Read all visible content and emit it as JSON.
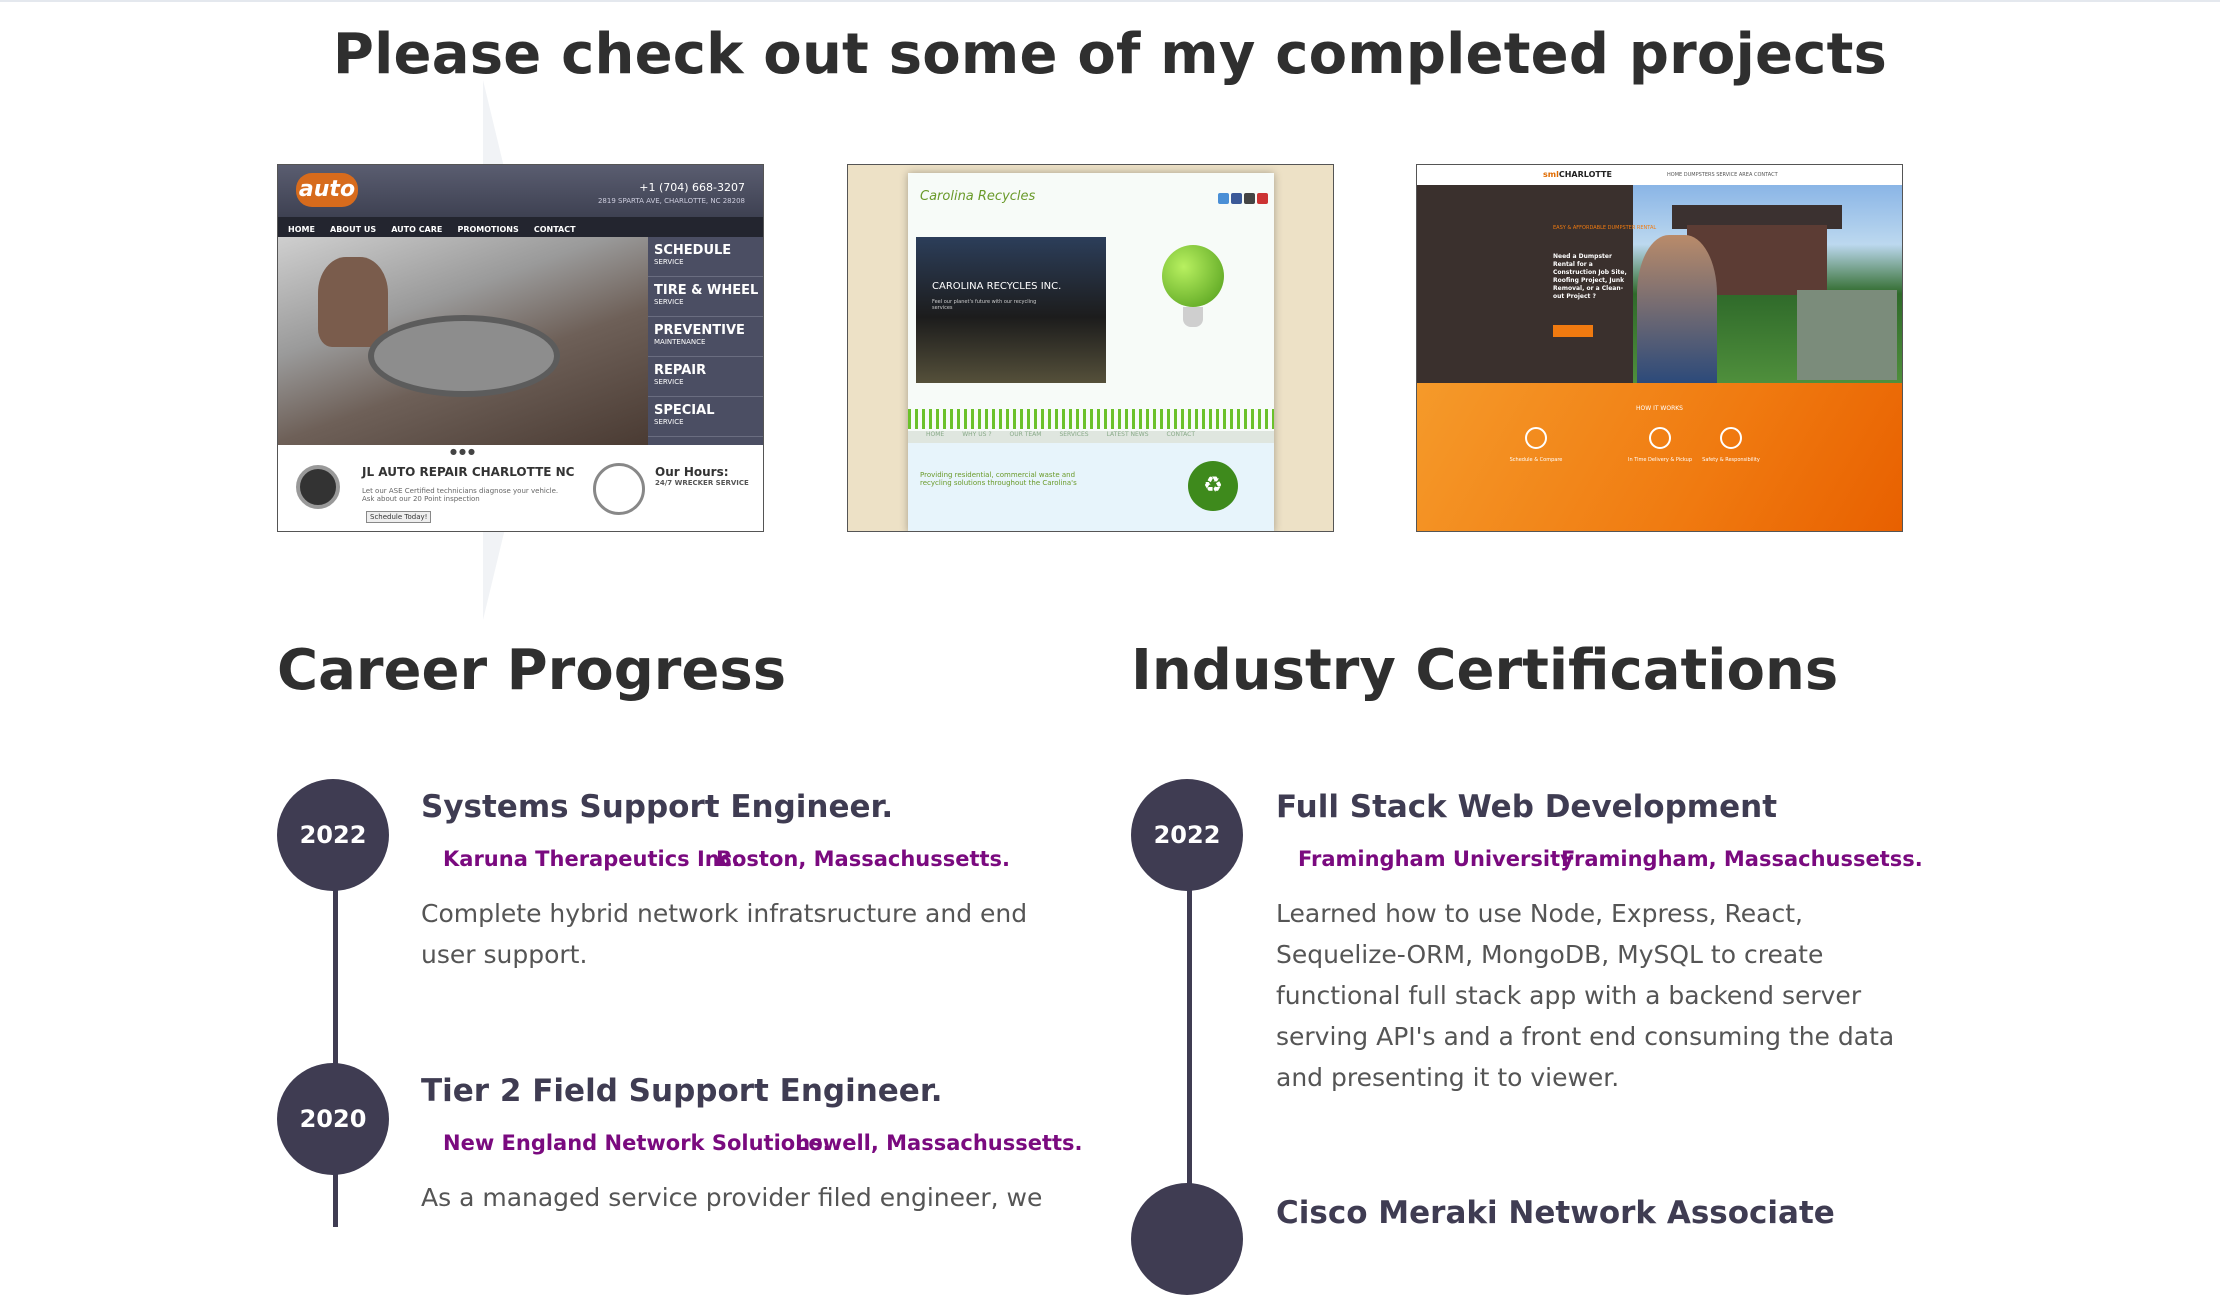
{
  "projects": {
    "title": "Please check out some of my completed projects",
    "thumb1": {
      "logo": "auto",
      "phone": "+1 (704) 668-3207",
      "address": "2819 SPARTA AVE, CHARLOTTE, NC 28208",
      "nav": [
        "HOME",
        "ABOUT US",
        "AUTO CARE",
        "PROMOTIONS",
        "CONTACT"
      ],
      "side_items": [
        {
          "label": "SCHEDULE",
          "sub": "SERVICE"
        },
        {
          "label": "TIRE & WHEEL",
          "sub": "SERVICE"
        },
        {
          "label": "PREVENTIVE",
          "sub": "MAINTENANCE"
        },
        {
          "label": "REPAIR",
          "sub": "SERVICE"
        },
        {
          "label": "SPECIAL",
          "sub": "SERVICE"
        }
      ],
      "company": "JL AUTO REPAIR CHARLOTTE NC",
      "blurb": "Let our ASE Certified technicians diagnose your vehicle. Ask about our 20 Point inspection",
      "button": "Schedule Today!",
      "hours_title": "Our Hours:",
      "hours_sub": "24/7 WRECKER SERVICE"
    },
    "thumb2": {
      "logo": "Carolina Recycles",
      "banner_title": "CAROLINA RECYCLES INC.",
      "banner_text": "Feel our planet's future with our recycling services",
      "nav": [
        "HOME",
        "WHY US ?",
        "OUR TEAM",
        "SERVICES",
        "LATEST NEWS",
        "CONTACT"
      ],
      "footer_text": "Providing residential, commercial waste and recycling solutions throughout the Carolina's"
    },
    "thumb3": {
      "logo_accent": "sml",
      "logo_text": "CHARLOTTE",
      "menu": "HOME  DUMPSTERS  SERVICE AREA  CONTACT",
      "tagline": "EASY & AFFORDABLE DUMPSTER RENTAL",
      "headline": "Need a Dumpster Rental for a Construction Job Site, Roofing Project, Junk Removal, or a Clean-out Project ?",
      "how": "HOW IT WORKS",
      "steps": [
        "Schedule & Compare",
        "In Time Delivery & Pickup",
        "Safety & Responsibility"
      ]
    }
  },
  "career": {
    "title": "Career Progress",
    "entries": [
      {
        "year": "2022",
        "role": "Systems Support Engineer.",
        "company": "Karuna Therapeutics Inc.",
        "location": "Boston, Massachussetts.",
        "desc_lines": [
          "Complete hybrid network infratsructure and end",
          "user support."
        ]
      },
      {
        "year": "2020",
        "role": "Tier 2 Field Support Engineer.",
        "company": "New England Network Solutions.",
        "location": "Lowell, Massachussetts.",
        "desc_lines": [
          "As a managed service provider filed engineer, we"
        ]
      }
    ]
  },
  "certifications": {
    "title": "Industry Certifications",
    "entries": [
      {
        "year": "2022",
        "role": "Full Stack Web Development",
        "company": "Framingham University",
        "location": "Framingham, Massachussetss.",
        "desc_lines": [
          "Learned how to use Node, Express, React,",
          "Sequelize-ORM, MongoDB, MySQL to create",
          "functional full stack app with a backend server",
          "serving API's and a front end consuming the data",
          "and presenting it to viewer."
        ]
      },
      {
        "year": "",
        "role": "Cisco Meraki Network Associate"
      }
    ]
  },
  "colors": {
    "timeline": "#3f3c52",
    "org": "#7a0a7f",
    "heading": "#2f2f2f"
  }
}
